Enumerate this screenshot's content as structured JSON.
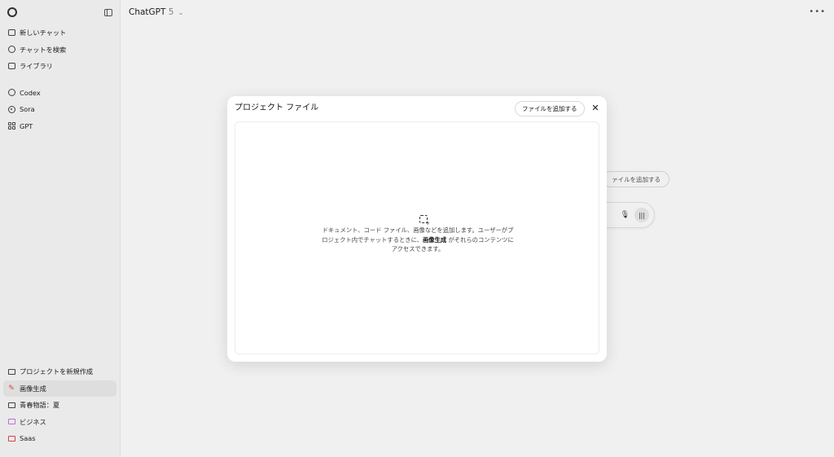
{
  "sidebar": {
    "nav": [
      {
        "label": "新しいチャット",
        "icon": "new-chat-icon"
      },
      {
        "label": "チャットを検索",
        "icon": "search-icon"
      },
      {
        "label": "ライブラリ",
        "icon": "library-icon"
      }
    ],
    "apps": [
      {
        "label": "Codex",
        "icon": "codex-icon"
      },
      {
        "label": "Sora",
        "icon": "sora-icon"
      },
      {
        "label": "GPT",
        "icon": "gpt-grid-icon"
      }
    ],
    "projects": [
      {
        "label": "プロジェクトを新規作成",
        "icon": "new-project-icon"
      },
      {
        "label": "画像生成",
        "icon": "pencil-icon"
      },
      {
        "label": "青春物語：夏",
        "icon": "folder-icon"
      },
      {
        "label": "ビジネス",
        "icon": "folder-icon"
      },
      {
        "label": "Saas",
        "icon": "folder-icon"
      }
    ]
  },
  "header": {
    "model_name": "ChatGPT",
    "model_version": "5"
  },
  "background": {
    "add_files_label": "ァイルを追加する"
  },
  "modal": {
    "title": "プロジェクト ファイル",
    "add_button_label": "ファイルを追加する",
    "close_label": "✕",
    "description_pre": "ドキュメント、コード ファイル、画像などを追加します。ユーザーがプロジェクト内でチャットするときに、",
    "description_bold": "画像生成",
    "description_post": " がそれらのコンテンツにアクセスできます。"
  },
  "colors": {
    "active_project_icon": "#e0484a",
    "folder_accent": "#c67ae0"
  }
}
